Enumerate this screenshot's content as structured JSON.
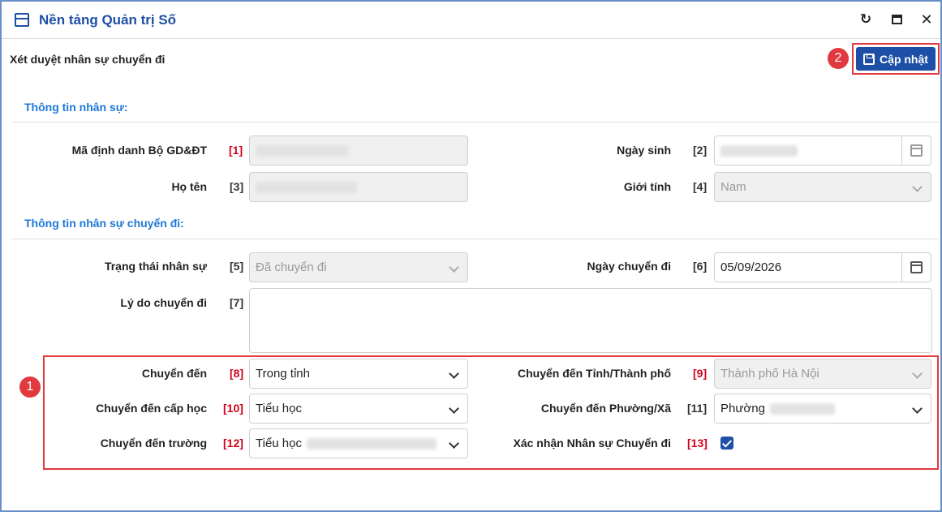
{
  "window": {
    "title": "Nền tảng Quản trị Số"
  },
  "header": {
    "title": "Xét duyệt nhân sự chuyển đi",
    "update_label": "Cập nhật"
  },
  "markers": {
    "one": "1",
    "two": "2"
  },
  "sections": {
    "personal": "Thông tin nhân sự:",
    "transfer": "Thông tin nhân sự chuyển đi:"
  },
  "fields": {
    "ma_dinh_danh": {
      "label": "Mã định danh Bộ GD&ĐT",
      "num": "[1]"
    },
    "ngay_sinh": {
      "label": "Ngày sinh",
      "num": "[2]"
    },
    "ho_ten": {
      "label": "Họ tên",
      "num": "[3]"
    },
    "gioi_tinh": {
      "label": "Giới tính",
      "num": "[4]",
      "value": "Nam"
    },
    "trang_thai": {
      "label": "Trạng thái nhân sự",
      "num": "[5]",
      "value": "Đã chuyển đi"
    },
    "ngay_chuyen_di": {
      "label": "Ngày chuyển đi",
      "num": "[6]",
      "value": "05/09/2026"
    },
    "ly_do": {
      "label": "Lý do chuyển đi",
      "num": "[7]",
      "value": ""
    },
    "chuyen_den": {
      "label": "Chuyển đến",
      "num": "[8]",
      "value": "Trong tỉnh"
    },
    "tinh_tp": {
      "label": "Chuyển đến Tỉnh/Thành phố",
      "num": "[9]",
      "value": "Thành phố Hà Nội"
    },
    "cap_hoc": {
      "label": "Chuyển đến cấp học",
      "num": "[10]",
      "value": "Tiểu học"
    },
    "phuong_xa": {
      "label": "Chuyển đến Phường/Xã",
      "num": "[11]",
      "value": "Phường"
    },
    "truong": {
      "label": "Chuyển đến trường",
      "num": "[12]",
      "value": "Tiểu học"
    },
    "xac_nhan": {
      "label": "Xác nhận Nhân sự Chuyển đi",
      "num": "[13]",
      "checked": true
    }
  },
  "colors": {
    "accent": "#1e4fa6",
    "section": "#1e78d7",
    "highlight": "#e0393e",
    "required": "#d0021b"
  },
  "icons": {
    "app": "window-icon",
    "refresh": "refresh-icon",
    "maximize": "maximize-icon",
    "close": "close-icon",
    "save": "save-icon",
    "calendar": "calendar-icon",
    "dropdown": "chevron-down-icon"
  }
}
